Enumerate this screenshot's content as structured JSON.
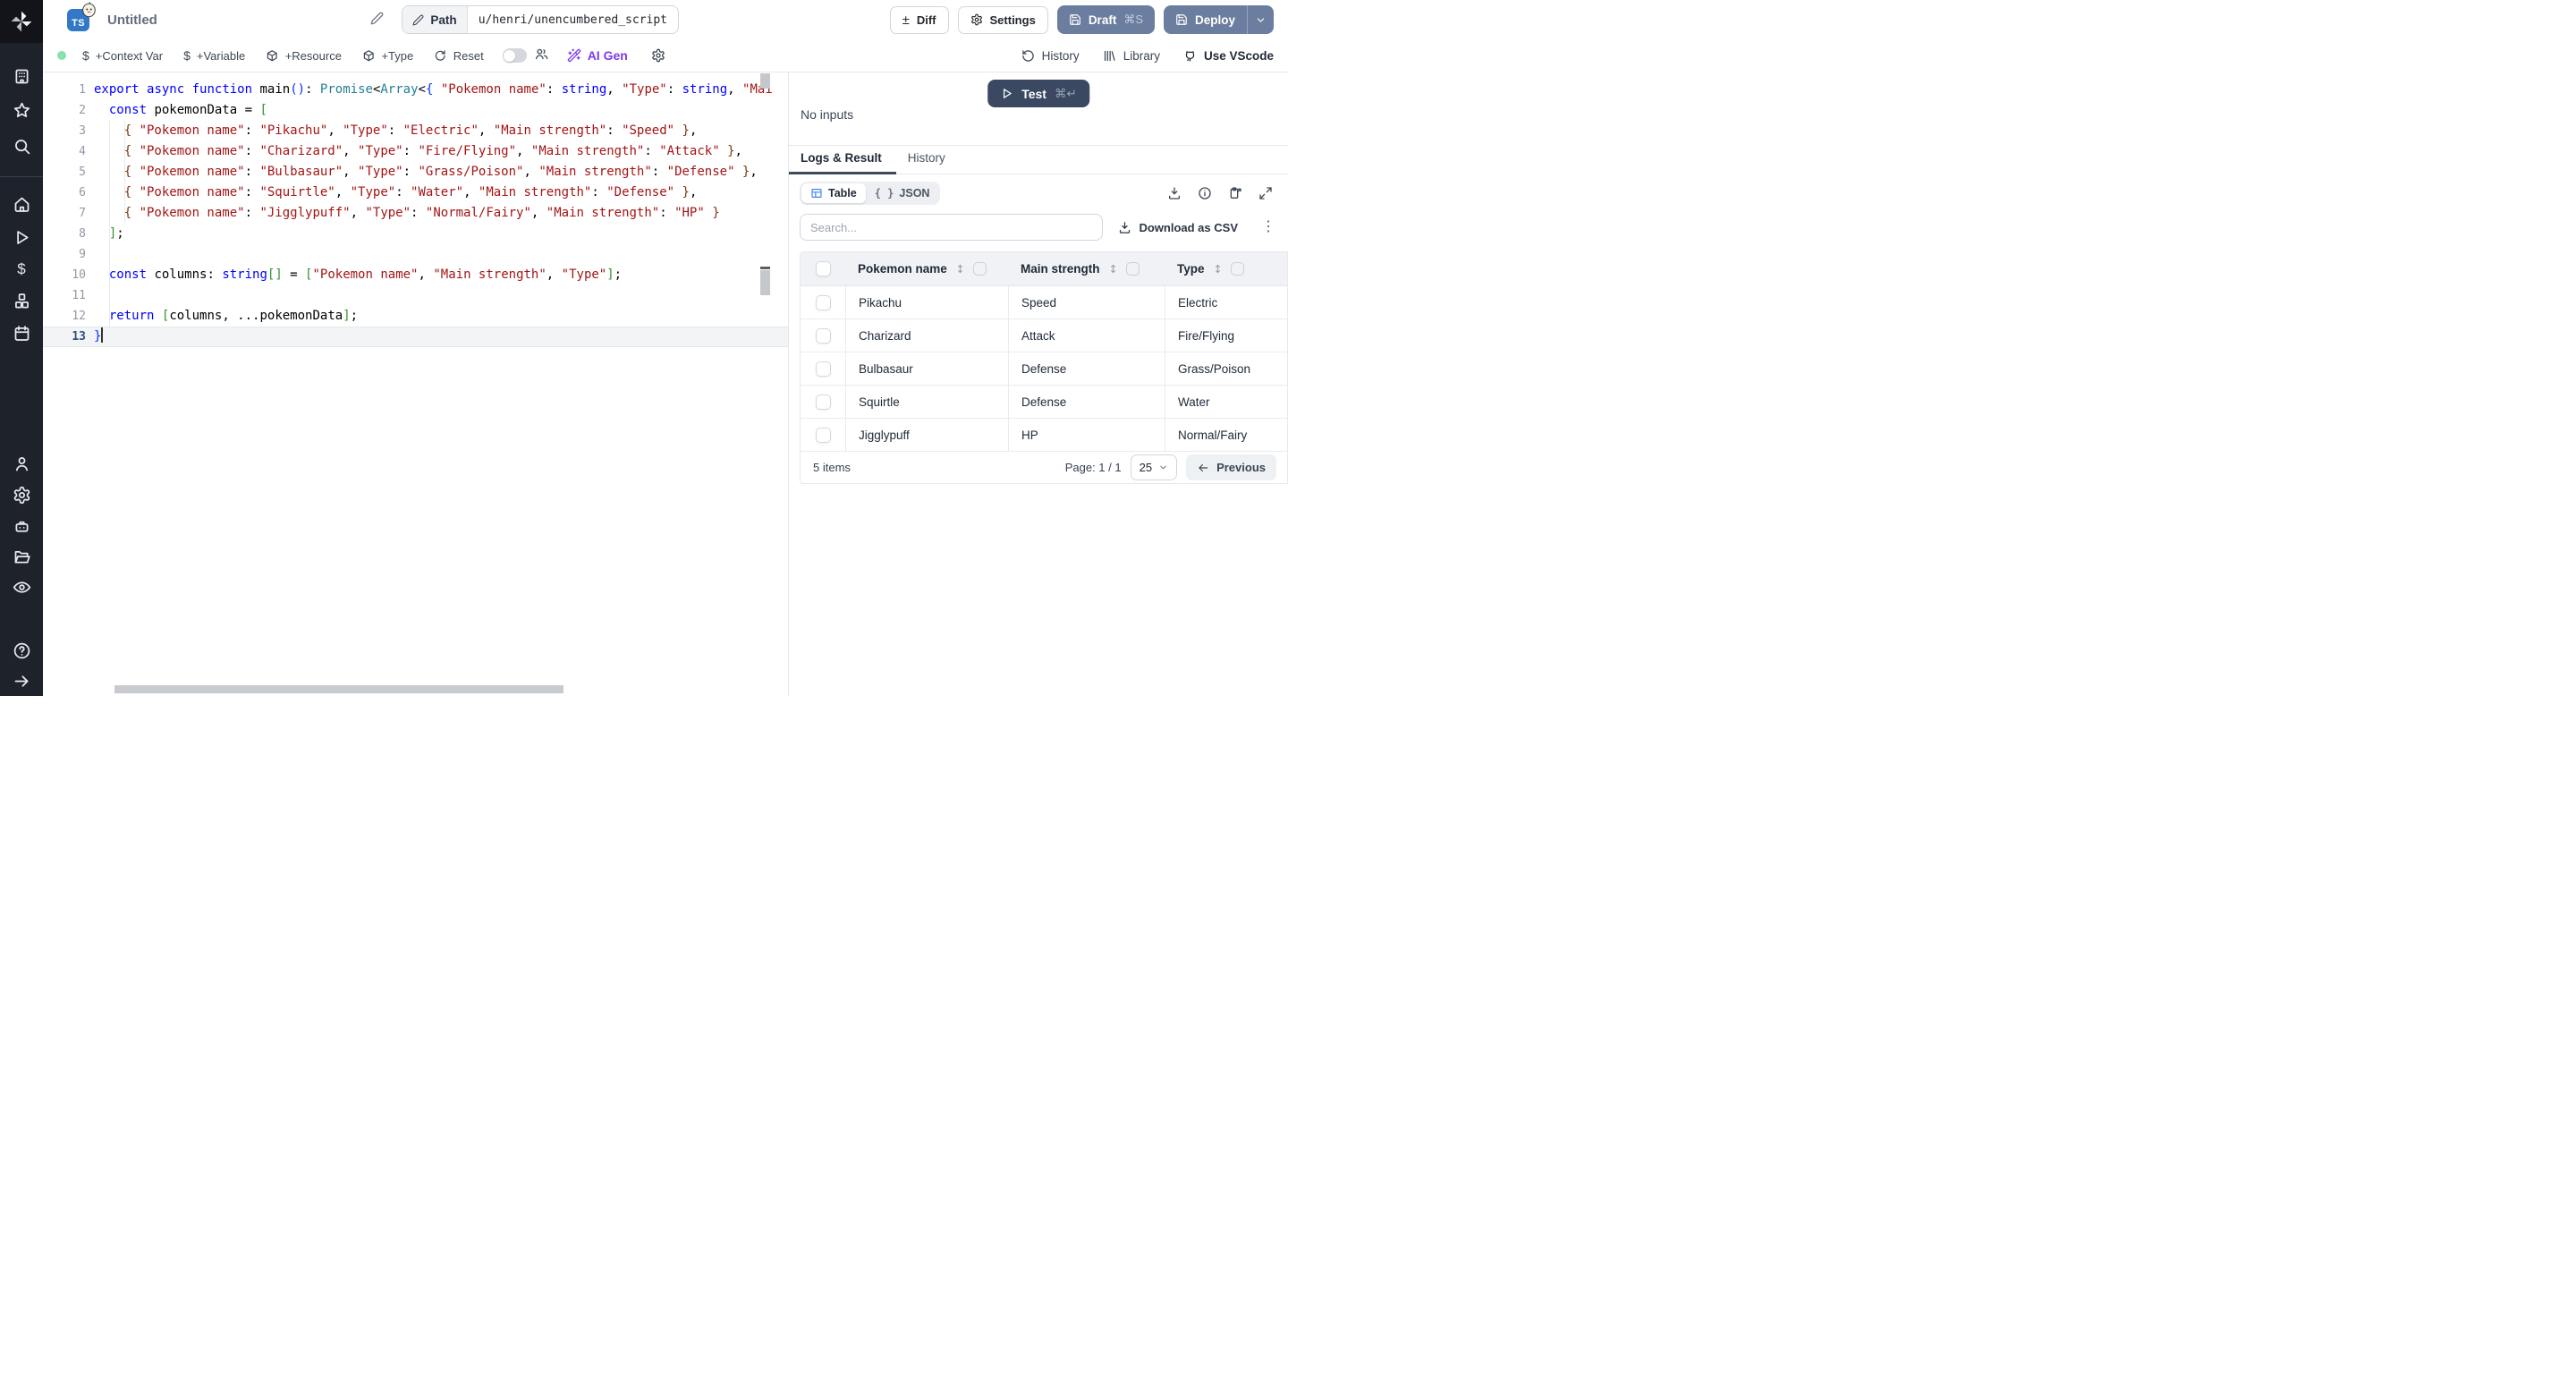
{
  "topbar": {
    "title": "Untitled",
    "file_type_badge": "TS",
    "path_label": "Path",
    "path_value": "u/henri/unencumbered_script",
    "diff_label": "Diff",
    "settings_label": "Settings",
    "draft_label": "Draft",
    "draft_shortcut": "⌘S",
    "deploy_label": "Deploy"
  },
  "toolbar": {
    "context_var": "+Context Var",
    "variable": "+Variable",
    "resource": "+Resource",
    "type": "+Type",
    "reset": "Reset",
    "ai_gen": "AI Gen",
    "history": "History",
    "library": "Library",
    "vscode": "Use VScode"
  },
  "editor": {
    "cursor_line": 13,
    "lines": [
      [
        [
          "k",
          "export"
        ],
        [
          "d",
          " "
        ],
        [
          "k",
          "async"
        ],
        [
          "d",
          " "
        ],
        [
          "k",
          "function"
        ],
        [
          "d",
          " main"
        ],
        [
          "b1",
          "()"
        ],
        [
          "d",
          ": "
        ],
        [
          "t",
          "Promise"
        ],
        [
          "d",
          "<"
        ],
        [
          "t",
          "Array"
        ],
        [
          "d",
          "<"
        ],
        [
          "b1",
          "{"
        ],
        [
          "d",
          " "
        ],
        [
          "s",
          "\"Pokemon name\""
        ],
        [
          "d",
          ": "
        ],
        [
          "k",
          "string"
        ],
        [
          "d",
          ", "
        ],
        [
          "s",
          "\"Type\""
        ],
        [
          "d",
          ": "
        ],
        [
          "k",
          "string"
        ],
        [
          "d",
          ", "
        ],
        [
          "s",
          "\"Mai"
        ]
      ],
      [
        [
          "d",
          "  "
        ],
        [
          "k",
          "const"
        ],
        [
          "d",
          " pokemonData = "
        ],
        [
          "b2",
          "["
        ]
      ],
      [
        [
          "d",
          "    "
        ],
        [
          "b3",
          "{ "
        ],
        [
          "s",
          "\"Pokemon name\""
        ],
        [
          "d",
          ": "
        ],
        [
          "s",
          "\"Pikachu\""
        ],
        [
          "d",
          ", "
        ],
        [
          "s",
          "\"Type\""
        ],
        [
          "d",
          ": "
        ],
        [
          "s",
          "\"Electric\""
        ],
        [
          "d",
          ", "
        ],
        [
          "s",
          "\"Main strength\""
        ],
        [
          "d",
          ": "
        ],
        [
          "s",
          "\"Speed\""
        ],
        [
          "b3",
          " }"
        ],
        [
          "d",
          ","
        ]
      ],
      [
        [
          "d",
          "    "
        ],
        [
          "b3",
          "{ "
        ],
        [
          "s",
          "\"Pokemon name\""
        ],
        [
          "d",
          ": "
        ],
        [
          "s",
          "\"Charizard\""
        ],
        [
          "d",
          ", "
        ],
        [
          "s",
          "\"Type\""
        ],
        [
          "d",
          ": "
        ],
        [
          "s",
          "\"Fire/Flying\""
        ],
        [
          "d",
          ", "
        ],
        [
          "s",
          "\"Main strength\""
        ],
        [
          "d",
          ": "
        ],
        [
          "s",
          "\"Attack\""
        ],
        [
          "b3",
          " }"
        ],
        [
          "d",
          ","
        ]
      ],
      [
        [
          "d",
          "    "
        ],
        [
          "b3",
          "{ "
        ],
        [
          "s",
          "\"Pokemon name\""
        ],
        [
          "d",
          ": "
        ],
        [
          "s",
          "\"Bulbasaur\""
        ],
        [
          "d",
          ", "
        ],
        [
          "s",
          "\"Type\""
        ],
        [
          "d",
          ": "
        ],
        [
          "s",
          "\"Grass/Poison\""
        ],
        [
          "d",
          ", "
        ],
        [
          "s",
          "\"Main strength\""
        ],
        [
          "d",
          ": "
        ],
        [
          "s",
          "\"Defense\""
        ],
        [
          "b3",
          " }"
        ],
        [
          "d",
          ","
        ]
      ],
      [
        [
          "d",
          "    "
        ],
        [
          "b3",
          "{ "
        ],
        [
          "s",
          "\"Pokemon name\""
        ],
        [
          "d",
          ": "
        ],
        [
          "s",
          "\"Squirtle\""
        ],
        [
          "d",
          ", "
        ],
        [
          "s",
          "\"Type\""
        ],
        [
          "d",
          ": "
        ],
        [
          "s",
          "\"Water\""
        ],
        [
          "d",
          ", "
        ],
        [
          "s",
          "\"Main strength\""
        ],
        [
          "d",
          ": "
        ],
        [
          "s",
          "\"Defense\""
        ],
        [
          "b3",
          " }"
        ],
        [
          "d",
          ","
        ]
      ],
      [
        [
          "d",
          "    "
        ],
        [
          "b3",
          "{ "
        ],
        [
          "s",
          "\"Pokemon name\""
        ],
        [
          "d",
          ": "
        ],
        [
          "s",
          "\"Jigglypuff\""
        ],
        [
          "d",
          ", "
        ],
        [
          "s",
          "\"Type\""
        ],
        [
          "d",
          ": "
        ],
        [
          "s",
          "\"Normal/Fairy\""
        ],
        [
          "d",
          ", "
        ],
        [
          "s",
          "\"Main strength\""
        ],
        [
          "d",
          ": "
        ],
        [
          "s",
          "\"HP\""
        ],
        [
          "b3",
          " }"
        ]
      ],
      [
        [
          "d",
          "  "
        ],
        [
          "b2",
          "]"
        ],
        [
          "d",
          ";"
        ]
      ],
      [],
      [
        [
          "d",
          "  "
        ],
        [
          "k",
          "const"
        ],
        [
          "d",
          " columns: "
        ],
        [
          "k",
          "string"
        ],
        [
          "b2",
          "[]"
        ],
        [
          "d",
          " = "
        ],
        [
          "b2",
          "["
        ],
        [
          "s",
          "\"Pokemon name\""
        ],
        [
          "d",
          ", "
        ],
        [
          "s",
          "\"Main strength\""
        ],
        [
          "d",
          ", "
        ],
        [
          "s",
          "\"Type\""
        ],
        [
          "b2",
          "]"
        ],
        [
          "d",
          ";"
        ]
      ],
      [],
      [
        [
          "d",
          "  "
        ],
        [
          "k",
          "return"
        ],
        [
          "d",
          " "
        ],
        [
          "b2",
          "["
        ],
        [
          "d",
          "columns, ...pokemonData"
        ],
        [
          "b2",
          "]"
        ],
        [
          "d",
          ";"
        ]
      ],
      [
        [
          "b1",
          "}"
        ]
      ]
    ]
  },
  "panel": {
    "test_label": "Test",
    "test_shortcut": "⌘↵",
    "no_inputs": "No inputs",
    "tabs": [
      "Logs & Result",
      "History"
    ],
    "view_table": "Table",
    "view_json": "JSON",
    "search_placeholder": "Search...",
    "download_csv": "Download as CSV",
    "table": {
      "columns": [
        "Pokemon name",
        "Main strength",
        "Type"
      ],
      "rows": [
        [
          "Pikachu",
          "Speed",
          "Electric"
        ],
        [
          "Charizard",
          "Attack",
          "Fire/Flying"
        ],
        [
          "Bulbasaur",
          "Defense",
          "Grass/Poison"
        ],
        [
          "Squirtle",
          "Defense",
          "Water"
        ],
        [
          "Jigglypuff",
          "HP",
          "Normal/Fairy"
        ]
      ]
    },
    "footer": {
      "count": "5 items",
      "page": "Page: 1 / 1",
      "page_size": "25",
      "previous": "Previous"
    }
  },
  "colors": {
    "deploy_button": "#6b7e9f",
    "test_button": "#3b4862",
    "ai_gen": "#7c3aed",
    "status_dot": "#86e3ac",
    "ts_icon": "#3178c6",
    "code_string": "#a31515",
    "code_keyword": "#0000ff",
    "code_type": "#267f99"
  }
}
